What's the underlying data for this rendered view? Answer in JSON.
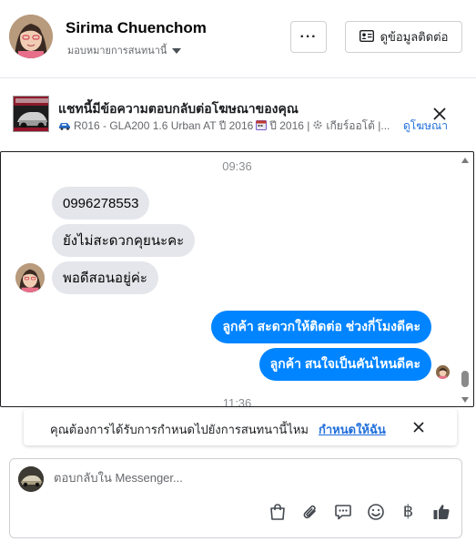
{
  "header": {
    "name": "Sirima Chuenchom",
    "subtitle": "มอบหมายการสนทนานี้",
    "more_label": "···",
    "contact_label": "ดูข้อมูลติดต่อ"
  },
  "ad": {
    "title": "แชทนี้มีข้อความตอบกลับต่อโฆษณาของคุณ",
    "car_info": "R016 - GLA200 1.6 Urban AT ปี 2016",
    "year_info": "ปี 2016 |",
    "gear_info": "เกียร์ออโต้ |...",
    "view_ad_label": "ดูโฆษณา"
  },
  "chat": {
    "time_top": "09:36",
    "messages_in": [
      "0996278553",
      "ยังไม่สะดวกคุยนะคะ",
      "พอดีสอนอยู่ค่ะ"
    ],
    "messages_out": [
      "ลูกค้า  สะดวกให้ติดต่อ ช่วงกี่โมงดีคะ",
      "ลูกค้า สนใจเป็นคันไหนดีคะ"
    ],
    "time_bottom": "11:36"
  },
  "reminder": {
    "text": "คุณต้องการได้รับการกำหนดไปยังการสนทนานี้ไหม",
    "link": "กำหนดให้ฉัน"
  },
  "composer": {
    "placeholder": "ตอบกลับใน Messenger...",
    "baht_symbol": "฿"
  },
  "colors": {
    "outgoing_bubble": "#0084ff",
    "incoming_bubble": "#e4e6eb",
    "link": "#216fdb",
    "like_icon": "#444950"
  }
}
